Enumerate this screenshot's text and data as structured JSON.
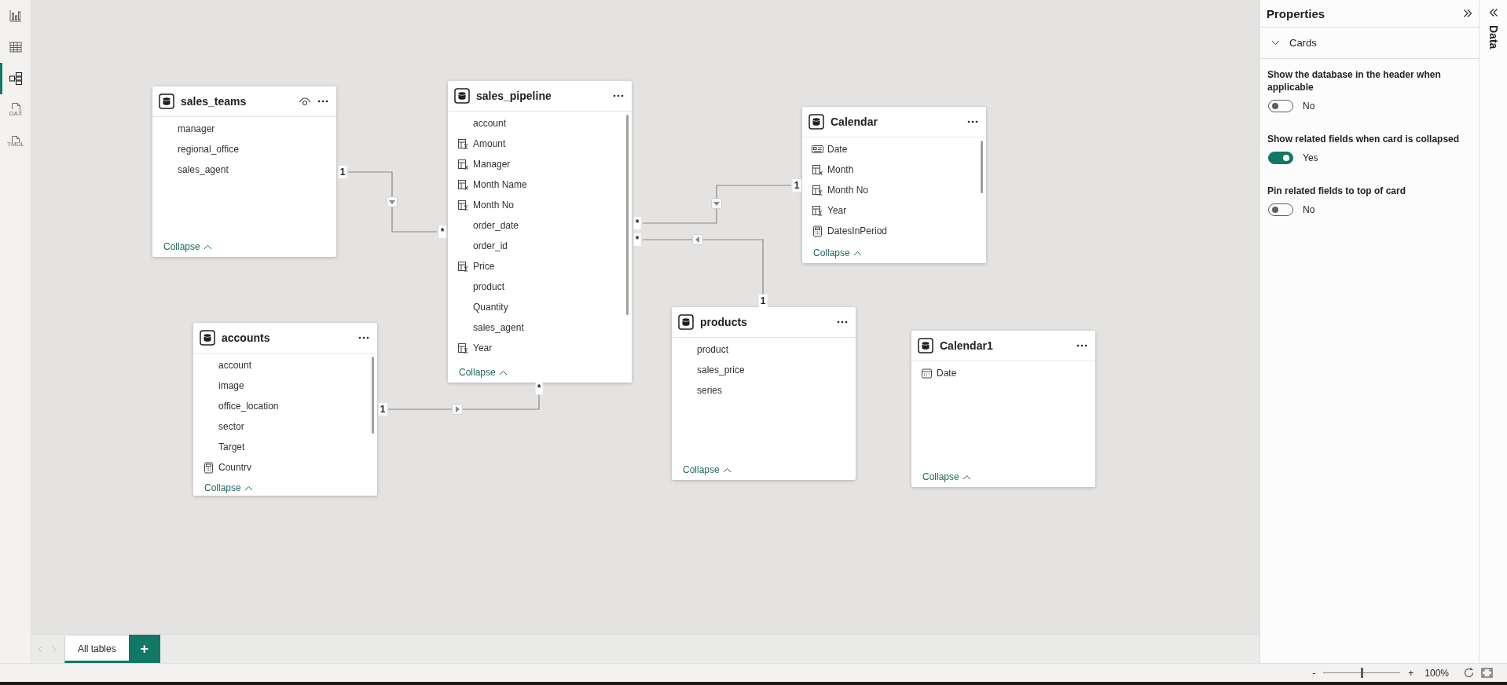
{
  "nav": [
    {
      "kind": "report",
      "selected": false
    },
    {
      "kind": "table",
      "selected": false
    },
    {
      "kind": "model",
      "selected": true
    },
    {
      "kind": "dax",
      "label": "DAX",
      "selected": false
    },
    {
      "kind": "tmdl",
      "label": "TMDL",
      "selected": false
    }
  ],
  "tables": [
    {
      "name": "sales_teams",
      "eye": true,
      "collapse_label": "Collapse",
      "fields": [
        {
          "name": "manager",
          "kind": "plain"
        },
        {
          "name": "regional_office",
          "kind": "plain"
        },
        {
          "name": "sales_agent",
          "kind": "plain"
        }
      ]
    },
    {
      "name": "sales_pipeline",
      "eye": false,
      "collapse_label": "Collapse",
      "fields": [
        {
          "name": "account",
          "kind": "plain"
        },
        {
          "name": "Amount",
          "kind": "sum"
        },
        {
          "name": "Manager",
          "kind": "fx"
        },
        {
          "name": "Month Name",
          "kind": "fx"
        },
        {
          "name": "Month No",
          "kind": "sum"
        },
        {
          "name": "order_date",
          "kind": "plain"
        },
        {
          "name": "order_id",
          "kind": "plain"
        },
        {
          "name": "Price",
          "kind": "sum"
        },
        {
          "name": "product",
          "kind": "plain"
        },
        {
          "name": "Quantity",
          "kind": "plain"
        },
        {
          "name": "sales_agent",
          "kind": "plain"
        },
        {
          "name": "Year",
          "kind": "sum"
        }
      ]
    },
    {
      "name": "Calendar",
      "eye": false,
      "collapse_label": "Collapse",
      "fields": [
        {
          "name": "Date",
          "kind": "card"
        },
        {
          "name": "Month",
          "kind": "fx"
        },
        {
          "name": "Month No",
          "kind": "sum"
        },
        {
          "name": "Year",
          "kind": "sum"
        },
        {
          "name": "DatesInPeriod",
          "kind": "calc"
        }
      ]
    },
    {
      "name": "accounts",
      "eye": false,
      "collapse_label": "Collapse",
      "fields": [
        {
          "name": "account",
          "kind": "plain"
        },
        {
          "name": "image",
          "kind": "plain"
        },
        {
          "name": "office_location",
          "kind": "plain"
        },
        {
          "name": "sector",
          "kind": "plain"
        },
        {
          "name": "Target",
          "kind": "plain"
        },
        {
          "name": "Countrv",
          "kind": "calc"
        }
      ]
    },
    {
      "name": "products",
      "eye": false,
      "collapse_label": "Collapse",
      "fields": [
        {
          "name": "product",
          "kind": "plain"
        },
        {
          "name": "sales_price",
          "kind": "plain"
        },
        {
          "name": "series",
          "kind": "plain"
        }
      ]
    },
    {
      "name": "Calendar1",
      "eye": false,
      "collapse_label": "Collapse",
      "fields": [
        {
          "name": "Date",
          "kind": "calendar"
        }
      ]
    }
  ],
  "relationships": [
    {
      "one_label": "1",
      "many_label": "*",
      "kind": "down"
    },
    {
      "one_label": "1",
      "many_label": "*",
      "kind": "down"
    },
    {
      "one_label": "1",
      "many_label": "*",
      "kind": "left"
    },
    {
      "one_label": "1",
      "many_label": "*",
      "kind": "right"
    }
  ],
  "properties": {
    "title": "Properties",
    "section": {
      "label": "Cards",
      "expanded": true
    },
    "settings": [
      {
        "label": "Show the database in the header when applicable",
        "on": false,
        "value": "No"
      },
      {
        "label": "Show related fields when card is collapsed",
        "on": true,
        "value": "Yes"
      },
      {
        "label": "Pin related fields to top of card",
        "on": false,
        "value": "No"
      }
    ]
  },
  "data_pane": {
    "label": "Data"
  },
  "page_tabs": [
    {
      "label": "All tables",
      "selected": true
    }
  ],
  "add_page": "+",
  "status_bar": {
    "zoom_out": "-",
    "zoom_slider": {
      "level": 0.5
    },
    "zoom_in": "+",
    "zoom": "100%"
  }
}
